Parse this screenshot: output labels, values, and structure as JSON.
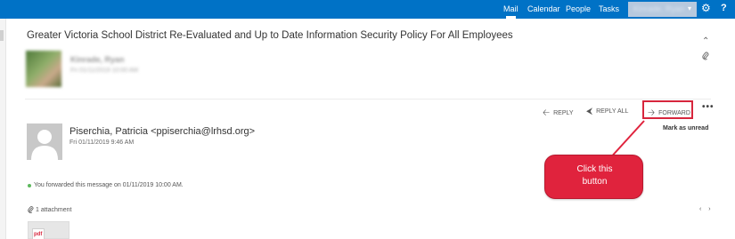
{
  "top_nav": {
    "mail": "Mail",
    "calendar": "Calendar",
    "people": "People",
    "tasks": "Tasks",
    "user_name": "Kinrade, Ryan",
    "user_caret": "▾",
    "gear_icon": "gear-icon",
    "help_label": "?"
  },
  "conversation": {
    "subject": "Greater Victoria School District Re-Evaluated and Up to Date Information Security Policy For All Employees",
    "collapse_icon": "double-chevron-up-icon",
    "attachment_icon": "paperclip-icon",
    "blurred_sender": "Kinrade, Ryan",
    "blurred_meta": "Fri 01/11/2019 10:00 AM"
  },
  "actions": {
    "reply": "REPLY",
    "reply_all": "REPLY ALL",
    "forward": "FORWARD",
    "more": "•••",
    "mark_unread": "Mark as unread",
    "highlight_color": "#d7263d"
  },
  "message": {
    "sender": "Piserchia, Patricia <ppiserchia@lrhsd.org>",
    "date": "Fri 01/11/2019 9:46 AM",
    "forward_note": "You forwarded this message on 01/11/2019 10:00 AM.",
    "forward_dot_color": "#5cb85c",
    "attachment_count": "1 attachment",
    "attachment_nav": "‹ ›",
    "attachment_type": "pdf"
  },
  "callout": {
    "line1": "Click this",
    "line2": "button",
    "color": "#e0233d"
  }
}
